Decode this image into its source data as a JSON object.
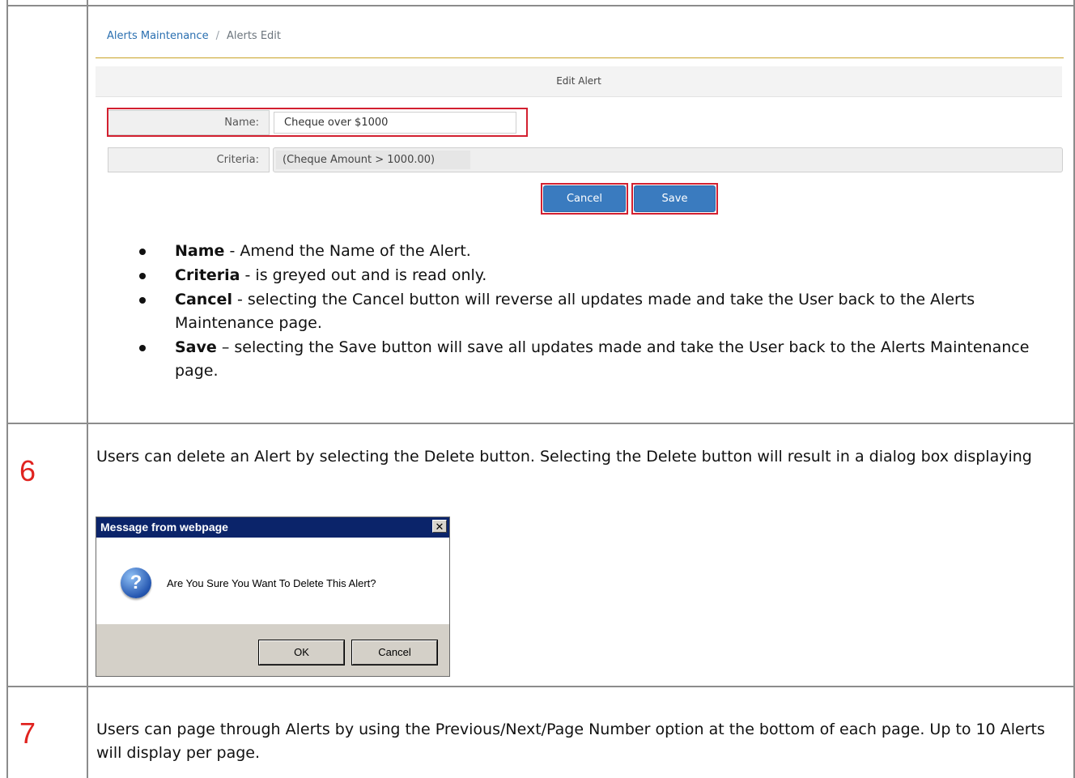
{
  "edit_screen": {
    "breadcrumb": {
      "link": "Alerts Maintenance",
      "separator": "/",
      "current": "Alerts Edit"
    },
    "panel_title": "Edit Alert",
    "name_label": "Name:",
    "name_value": "Cheque over $1000",
    "criteria_label": "Criteria:",
    "criteria_value": "(Cheque Amount > 1000.00)",
    "cancel_label": "Cancel",
    "save_label": "Save",
    "highlight_color": "#d32030",
    "button_color": "#3a7bbf"
  },
  "bullets": [
    {
      "term": "Name",
      "text": " - Amend the Name of the Alert."
    },
    {
      "term": "Criteria",
      "text": " - is greyed out and is read only."
    },
    {
      "term": "Cancel",
      "text": " - selecting the Cancel button will reverse all updates made and take the User back to the Alerts Maintenance page."
    },
    {
      "term": "Save",
      "text": " – selecting the Save button will save all updates made and take the User back to the Alerts Maintenance page."
    }
  ],
  "step6": {
    "number": "6",
    "text": "Users can delete an Alert by selecting the Delete button. Selecting the Delete button will result in a dialog box displaying"
  },
  "dialog": {
    "title": "Message from webpage",
    "close_glyph": "✕",
    "icon_glyph": "?",
    "message": "Are You Sure You Want To Delete This Alert?",
    "ok_label": "OK",
    "cancel_label": "Cancel"
  },
  "step7": {
    "number": "7",
    "text": "Users can page through Alerts by using the Previous/Next/Page Number option at the bottom of each page. Up to 10 Alerts will display per page."
  },
  "step_number_color": "#e0231f"
}
